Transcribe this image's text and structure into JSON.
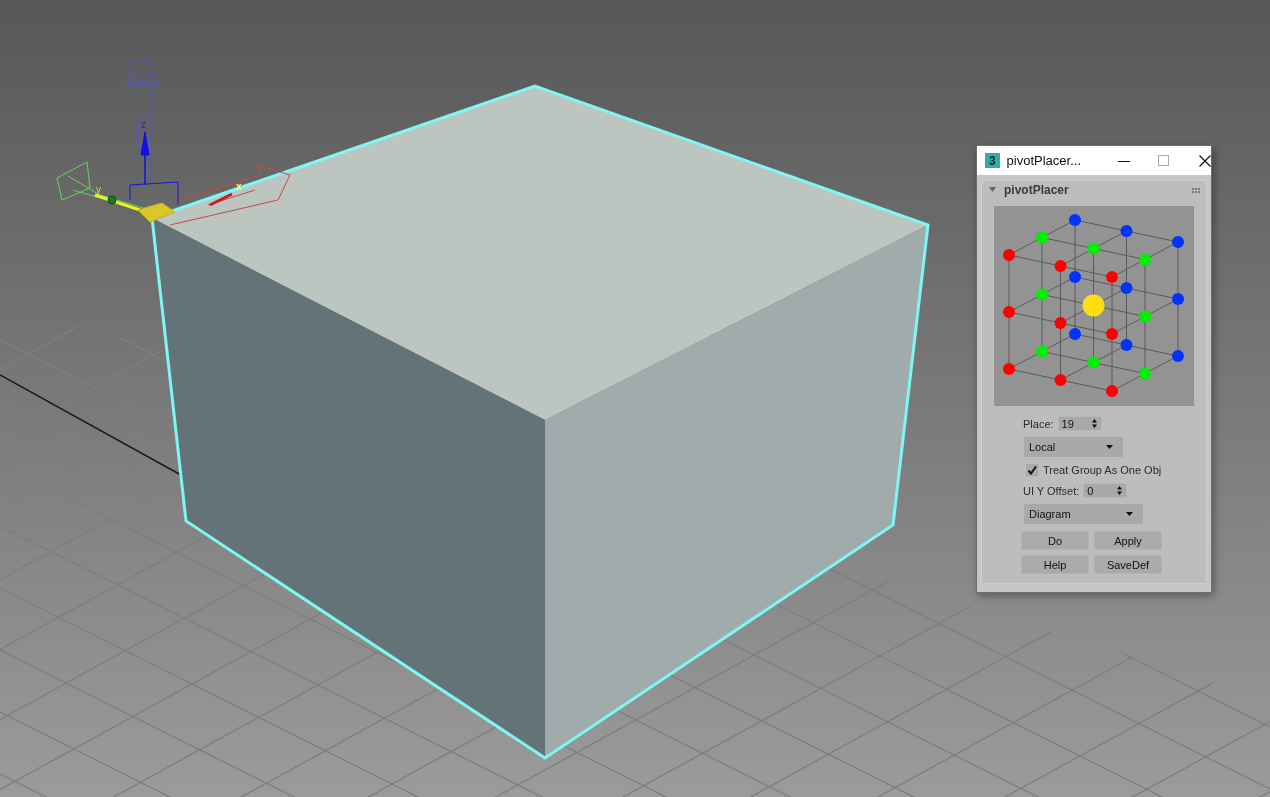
{
  "viewport": {
    "gizmo": {
      "x_label": "x",
      "y_label": "y",
      "z_label": "z"
    }
  },
  "window": {
    "icon_text": "3",
    "title": "pivotPlacer..."
  },
  "rollout": {
    "title": "pivotPlacer",
    "expanded": true
  },
  "place": {
    "label": "Place:",
    "value": "19"
  },
  "space_dropdown": {
    "value": "Local"
  },
  "treat_group": {
    "label": "Treat Group As One Obj",
    "checked": true
  },
  "ui_offset": {
    "label": "UI Y Offset:",
    "value": "0"
  },
  "mode_dropdown": {
    "value": "Diagram"
  },
  "buttons": [
    "Do",
    "Apply",
    "Help",
    "SaveDef"
  ]
}
